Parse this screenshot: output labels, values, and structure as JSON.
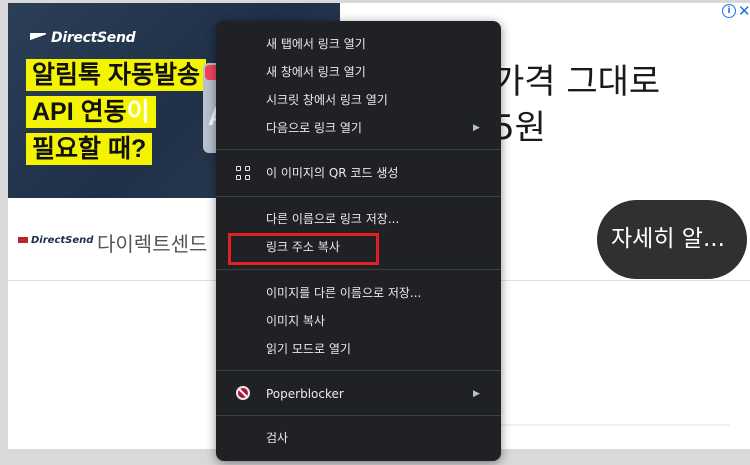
{
  "ad": {
    "brand": "DirectSend",
    "headline_line1": "알림톡 자동발송",
    "headline_line2_part1": "API 연동",
    "headline_line2_part2": "이",
    "headline_line3": "필요할 때?",
    "decor_letter": "A",
    "big_text_line1": "가격 그대로",
    "big_text_line2": "5원",
    "advertiser_logo": "DirectSend",
    "advertiser_name": "다이렉트센드",
    "cta_label": "자세히 알...",
    "info_icon": "i",
    "close_icon": "✕"
  },
  "context_menu": {
    "items": [
      {
        "label": "새 탭에서 링크 열기",
        "icon": "none",
        "submenu": false
      },
      {
        "label": "새 창에서 링크 열기",
        "icon": "none",
        "submenu": false
      },
      {
        "label": "시크릿 창에서 링크 열기",
        "icon": "none",
        "submenu": false
      },
      {
        "label": "다음으로 링크 열기",
        "icon": "none",
        "submenu": true
      },
      {
        "label": "이 이미지의 QR 코드 생성",
        "icon": "qr-code-icon",
        "submenu": false
      },
      {
        "label": "다른 이름으로 링크 저장...",
        "icon": "none",
        "submenu": false
      },
      {
        "label": "링크 주소 복사",
        "icon": "none",
        "submenu": false,
        "highlighted": true
      },
      {
        "label": "이미지를 다른 이름으로 저장...",
        "icon": "none",
        "submenu": false
      },
      {
        "label": "이미지 복사",
        "icon": "none",
        "submenu": false
      },
      {
        "label": "읽기 모드로 열기",
        "icon": "none",
        "submenu": false
      },
      {
        "label": "Poperblocker",
        "icon": "poperblocker-icon",
        "submenu": true
      },
      {
        "label": "검사",
        "icon": "none",
        "submenu": false
      }
    ],
    "submenu_arrow": "▶",
    "highlight_color": "#e01f26"
  },
  "colors": {
    "menu_bg": "#202124",
    "menu_text": "#e8eaed",
    "ad_headline_bg": "#f4f400",
    "cta_bg": "#303030"
  }
}
